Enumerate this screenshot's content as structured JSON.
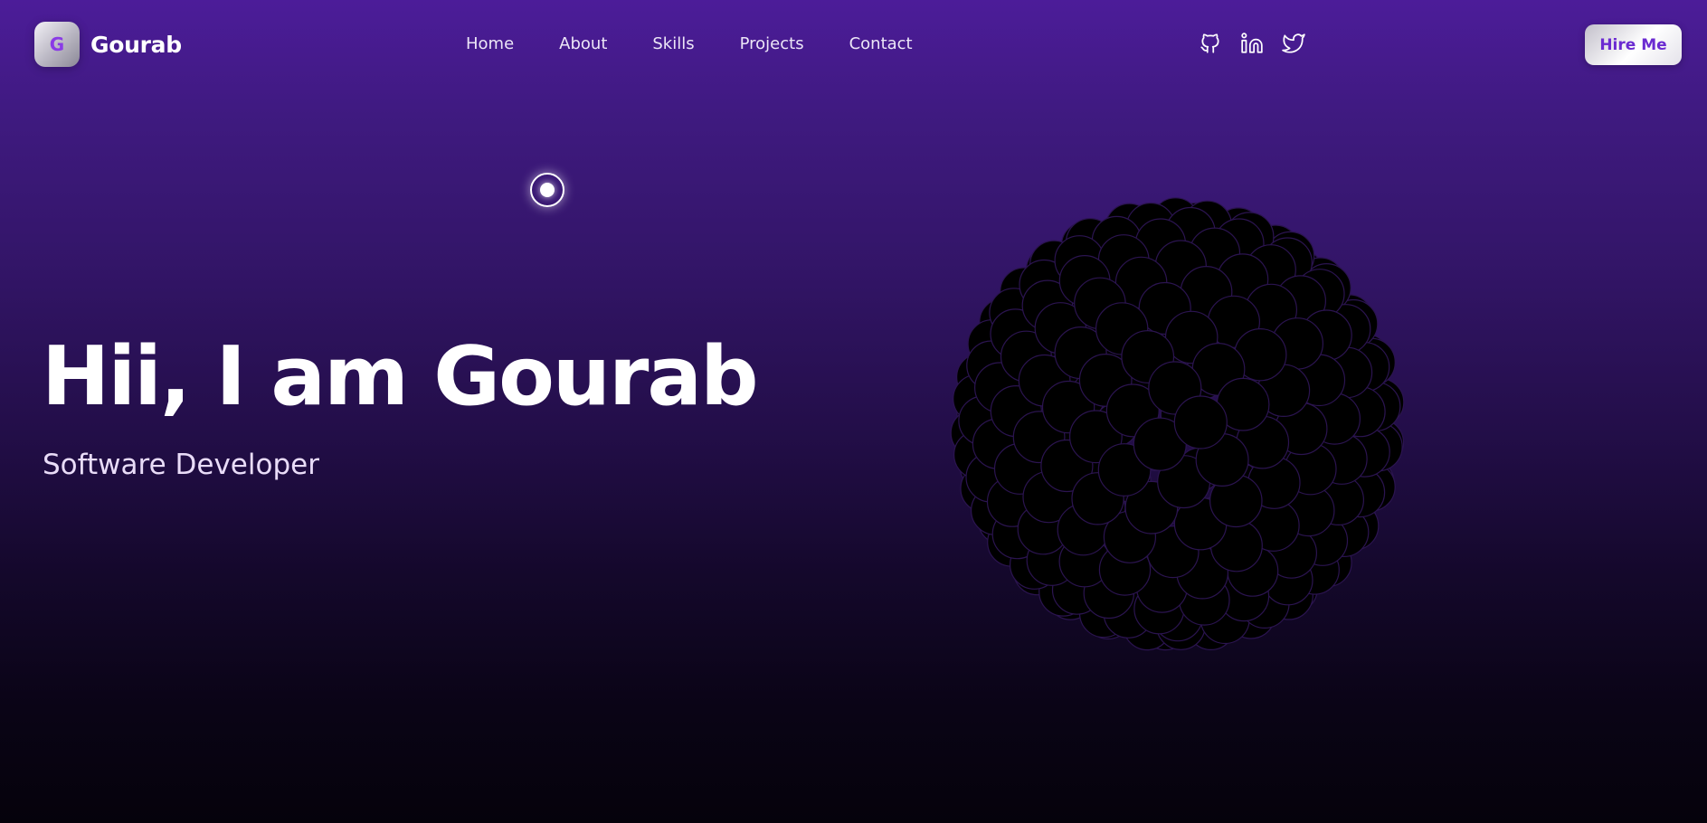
{
  "brand": {
    "logo_letter": "G",
    "name": "Gourab"
  },
  "nav": {
    "links": [
      {
        "label": "Home"
      },
      {
        "label": "About"
      },
      {
        "label": "Skills"
      },
      {
        "label": "Projects"
      },
      {
        "label": "Contact"
      }
    ]
  },
  "socials": [
    {
      "icon": "github-icon"
    },
    {
      "icon": "linkedin-icon"
    },
    {
      "icon": "twitter-icon"
    }
  ],
  "cta": {
    "hire_label": "Hire Me"
  },
  "hero": {
    "title": "Hii, I am Gourab",
    "subtitle": "Software Developer"
  },
  "colors": {
    "accent": "#8a3be6",
    "top_background": "#4c1c99",
    "bottom_background": "#05020b",
    "sphere_ball": "#000000"
  }
}
